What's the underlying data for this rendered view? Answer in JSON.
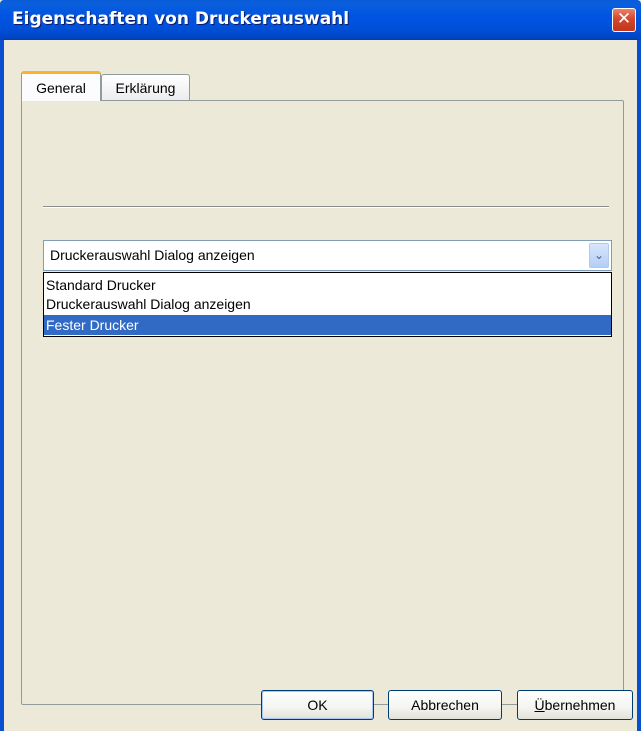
{
  "window": {
    "title": "Eigenschaften von Druckerauswahl",
    "close_label": "✕"
  },
  "tabs": [
    {
      "label": "General",
      "active": true
    },
    {
      "label": "Erklärung",
      "active": false
    }
  ],
  "combo": {
    "selected_value": "Druckerauswahl Dialog anzeigen",
    "arrow_icon": "chevron-down-icon",
    "arrow_glyph": "⌄"
  },
  "dropdown": {
    "options": [
      {
        "label": "Standard Drucker",
        "highlighted": false
      },
      {
        "label": "Druckerauswahl Dialog anzeigen",
        "highlighted": false
      },
      {
        "label": "Fester Drucker",
        "highlighted": true
      }
    ]
  },
  "buttons": {
    "ok_label": "OK",
    "cancel_label": "Abbrechen",
    "apply_mnemonic": "Ü",
    "apply_rest": "bernehmen"
  },
  "colors": {
    "titlebar": "#0054e3",
    "highlight": "#316ac5",
    "face": "#ece9d8",
    "close_button": "#d2492d",
    "active_tab_accent": "#f9b12f"
  }
}
